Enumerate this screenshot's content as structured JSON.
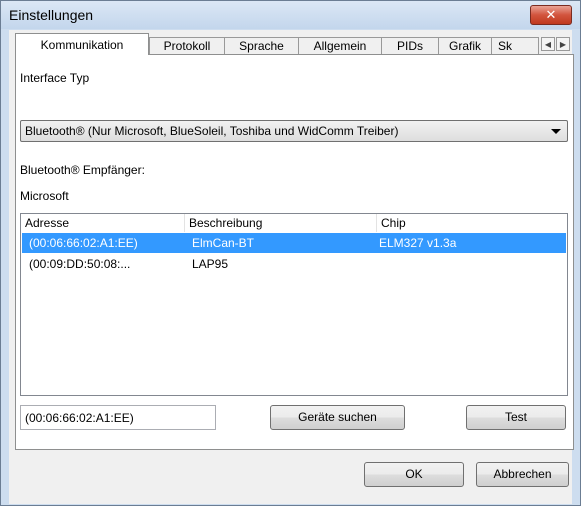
{
  "window": {
    "title": "Einstellungen",
    "close_glyph": "✕"
  },
  "tabs": [
    {
      "label": "Kommunikation",
      "active": true
    },
    {
      "label": "Protokoll"
    },
    {
      "label": "Sprache"
    },
    {
      "label": "Allgemein"
    },
    {
      "label": "PIDs"
    },
    {
      "label": "Grafik"
    },
    {
      "label": "Sk"
    }
  ],
  "tab_scroll": {
    "left": "◀",
    "right": "▶"
  },
  "interface": {
    "label": "Interface Typ",
    "selected": "Bluetooth® (Nur Microsoft, BlueSoleil, Toshiba und WidComm Treiber)"
  },
  "receiver": {
    "label": "Bluetooth® Empfänger:",
    "value": "Microsoft"
  },
  "device_list": {
    "columns": [
      "Adresse",
      "Beschreibung",
      "Chip"
    ],
    "rows": [
      {
        "address": "(00:06:66:02:A1:EE)",
        "description": "ElmCan-BT",
        "chip": "ELM327 v1.3a",
        "selected": true
      },
      {
        "address": "(00:09:DD:50:08:...",
        "description": "LAP95",
        "chip": ""
      }
    ]
  },
  "address_field": {
    "value": "(00:06:66:02:A1:EE)"
  },
  "buttons": {
    "search": "Geräte suchen",
    "test": "Test",
    "ok": "OK",
    "cancel": "Abbrechen"
  },
  "colors": {
    "selection": "#3399ff",
    "window_frame": "#cdddef",
    "close_button": "#c0391f"
  }
}
